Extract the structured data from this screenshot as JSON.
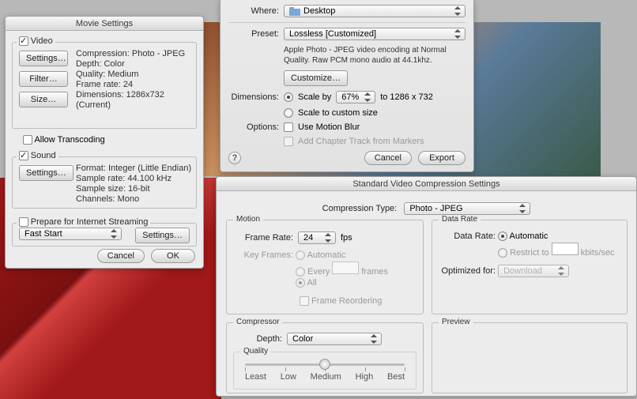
{
  "movie": {
    "title": "Movie Settings",
    "video_label": "Video",
    "video_checked": true,
    "btn_settings": "Settings…",
    "btn_filter": "Filter…",
    "btn_size": "Size…",
    "video_info": {
      "compression": "Compression: Photo - JPEG",
      "depth": "Depth: Color",
      "quality": "Quality: Medium",
      "framerate": "Frame rate: 24",
      "dimensions": "Dimensions: 1286x732 (Current)"
    },
    "allow_transcoding": "Allow Transcoding",
    "sound_label": "Sound",
    "sound_checked": true,
    "sound_info": {
      "format": "Format: Integer (Little Endian)",
      "samplerate": "Sample rate: 44.100 kHz",
      "samplesize": "Sample size: 16-bit",
      "channels": "Channels: Mono"
    },
    "prepare_label": "Prepare for Internet Streaming",
    "fast_start": "Fast Start",
    "btn_settings2": "Settings…",
    "cancel": "Cancel",
    "ok": "OK"
  },
  "export": {
    "where_label": "Where:",
    "where_value": "Desktop",
    "preset_label": "Preset:",
    "preset_value": "Lossless [Customized]",
    "preset_desc": "Apple Photo - JPEG video encoding at Normal Quality.  Raw PCM mono audio at 44.1khz.",
    "customize": "Customize…",
    "dimensions_label": "Dimensions:",
    "scale_by": "Scale by",
    "scale_value": "67%",
    "scale_to": "to 1286 x 732",
    "scale_custom": "Scale to custom size",
    "options_label": "Options:",
    "use_motion_blur": "Use Motion Blur",
    "add_chapter": "Add Chapter Track from Markers",
    "cancel": "Cancel",
    "export_btn": "Export"
  },
  "svcs": {
    "title": "Standard Video Compression Settings",
    "comp_type_label": "Compression Type:",
    "comp_type_value": "Photo - JPEG",
    "motion": "Motion",
    "frame_rate_label": "Frame Rate:",
    "frame_rate_value": "24",
    "fps": "fps",
    "key_frames_label": "Key Frames:",
    "kf_auto": "Automatic",
    "kf_every": "Every",
    "kf_frames": "frames",
    "kf_all": "All",
    "frame_reorder": "Frame Reordering",
    "data_rate": "Data Rate",
    "data_rate_label": "Data Rate:",
    "dr_auto": "Automatic",
    "dr_restrict": "Restrict to",
    "dr_unit": "kbits/sec",
    "optimized_label": "Optimized for:",
    "optimized_value": "Download",
    "compressor": "Compressor",
    "depth_label": "Depth:",
    "depth_value": "Color",
    "quality_label": "Quality",
    "q_ticks": [
      "Least",
      "Low",
      "Medium",
      "High",
      "Best"
    ],
    "preview": "Preview"
  }
}
